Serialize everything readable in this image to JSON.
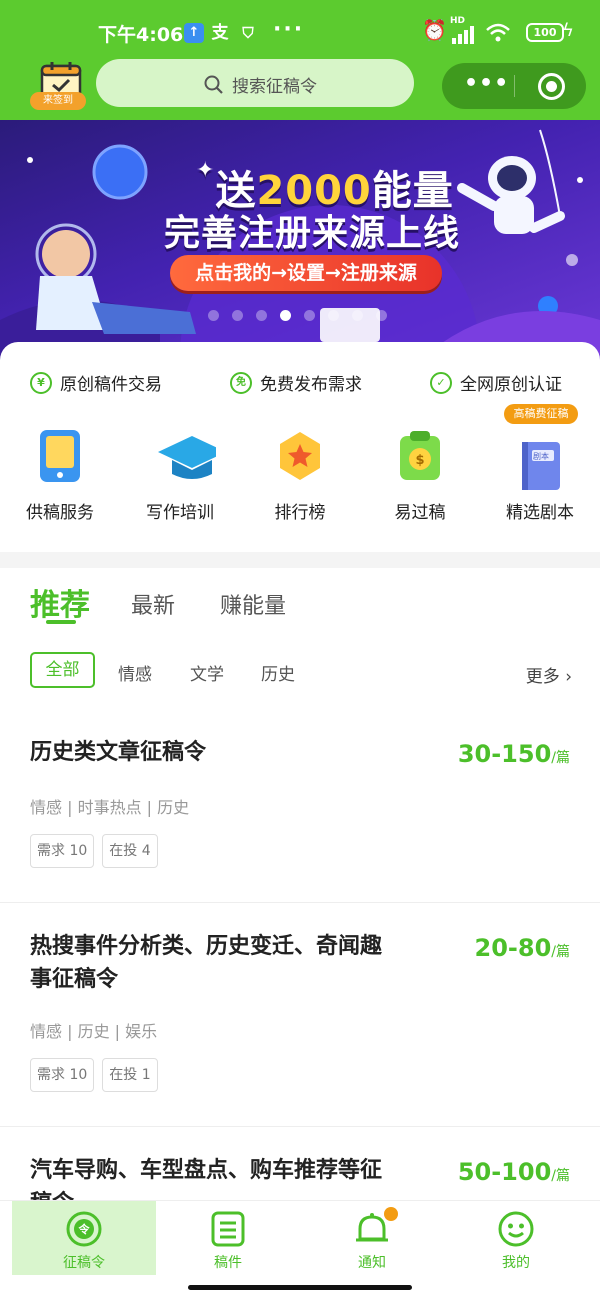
{
  "status_bar": {
    "time": "下午4:06",
    "hd_label": "HD",
    "battery": "100",
    "more": "···"
  },
  "header": {
    "checkin_label": "来签到",
    "search_placeholder": "搜索征稿令",
    "capsule_more": "•••"
  },
  "banner": {
    "line1_prefix": "送",
    "line1_highlight": "2000",
    "line1_suffix": "能量",
    "line2": "完善注册来源上线",
    "cta": "点击我的→设置→注册来源",
    "page_count": 8,
    "active_page": 3
  },
  "features": [
    {
      "icon": "yuan-icon",
      "glyph": "¥",
      "label": "原创稿件交易"
    },
    {
      "icon": "free-icon",
      "glyph": "免",
      "label": "免费发布需求"
    },
    {
      "icon": "shield-check-icon",
      "glyph": "✓",
      "label": "全网原创认证"
    }
  ],
  "services": [
    {
      "icon": "tablet-icon",
      "label": "供稿服务"
    },
    {
      "icon": "graduation-cap-icon",
      "label": "写作培训"
    },
    {
      "icon": "star-badge-icon",
      "label": "排行榜"
    },
    {
      "icon": "money-clipboard-icon",
      "label": "易过稿"
    },
    {
      "icon": "script-book-icon",
      "label": "精选剧本",
      "badge": "高稿费征稿",
      "book_label": "剧本"
    }
  ],
  "main_tabs": [
    {
      "label": "推荐",
      "active": true
    },
    {
      "label": "最新",
      "active": false
    },
    {
      "label": "赚能量",
      "active": false
    }
  ],
  "sub_tabs": [
    {
      "label": "全部",
      "active": true
    },
    {
      "label": "情感",
      "active": false
    },
    {
      "label": "文学",
      "active": false
    },
    {
      "label": "历史",
      "active": false
    }
  ],
  "more_label": "更多",
  "posts": [
    {
      "title": "历史类文章征稿令",
      "price": "30-150",
      "unit": "/篇",
      "categories": "情感 | 时事热点 | 历史",
      "demand": "需求 10",
      "submitted": "在投 4"
    },
    {
      "title": "热搜事件分析类、历史变迁、奇闻趣事征稿令",
      "price": "20-80",
      "unit": "/篇",
      "categories": "情感 | 历史 | 娱乐",
      "demand": "需求 10",
      "submitted": "在投 1"
    },
    {
      "title": "汽车导购、车型盘点、购车推荐等征稿令",
      "price": "50-100",
      "unit": "/篇"
    }
  ],
  "bottom_nav": [
    {
      "icon": "call-for-papers-icon",
      "label": "征稿令",
      "active": true
    },
    {
      "icon": "manuscript-icon",
      "label": "稿件",
      "active": false
    },
    {
      "icon": "bell-icon",
      "label": "通知",
      "active": false,
      "dot": true
    },
    {
      "icon": "smiley-icon",
      "label": "我的",
      "active": false
    }
  ],
  "colors": {
    "brand_green": "#5ccb2f",
    "accent_green": "#4cbf2a",
    "orange": "#f39c12",
    "banner_purple": "#4322b0"
  }
}
